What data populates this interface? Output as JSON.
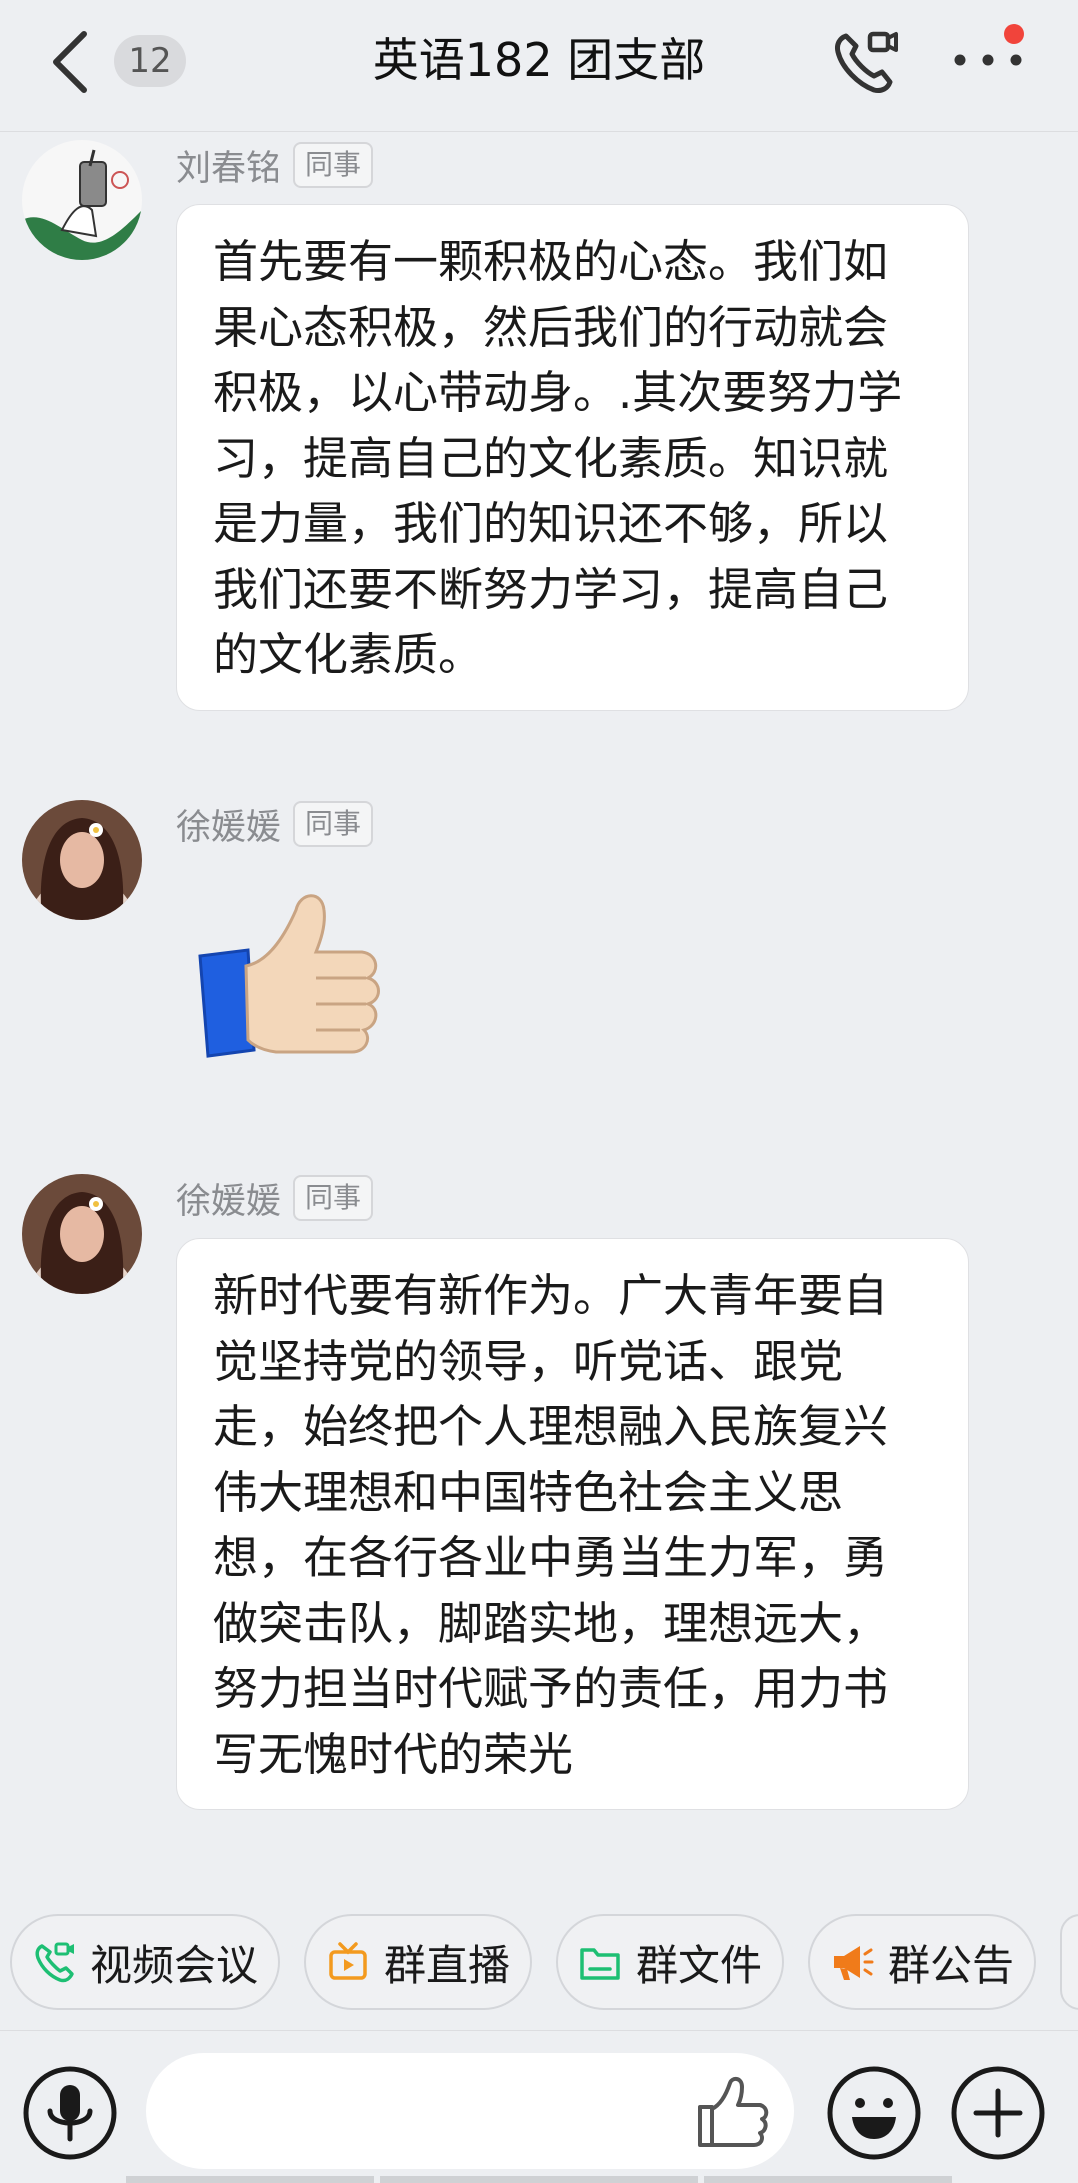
{
  "header": {
    "back_label": "back",
    "unread_count": "12",
    "title": "英语182 团支部",
    "has_notification_dot": true
  },
  "messages": [
    {
      "sender": "刘春铭",
      "tag": "同事",
      "text": "首先要有一颗积极的心态。我们如果心态积极，然后我们的行动就会积极，以心带动身。.其次要努力学习，提高自己的文化素质。知识就是力量，我们的知识还不够，所以我们还要不断努力学习，提高自己的文化素质。"
    },
    {
      "sender": "徐媛媛",
      "tag": "同事",
      "sticker": "thumbs-up"
    },
    {
      "sender": "徐媛媛",
      "tag": "同事",
      "text": "新时代要有新作为。广大青年要自觉坚持党的领导，听党话、跟党走，始终把个人理想融入民族复兴伟大理想和中国特色社会主义思想，在各行各业中勇当生力军，勇做突击队，脚踏实地，理想远大，努力担当时代赋予的责任，用力书写无愧时代的荣光"
    }
  ],
  "quick_actions": [
    {
      "label": "视频会议",
      "icon": "video-call-icon",
      "color": "#1dbf73"
    },
    {
      "label": "群直播",
      "icon": "live-tv-icon",
      "color": "#f39a1e"
    },
    {
      "label": "群文件",
      "icon": "folder-icon",
      "color": "#1dbf73"
    },
    {
      "label": "群公告",
      "icon": "megaphone-icon",
      "color": "#f07b1a"
    }
  ],
  "input": {
    "placeholder": ""
  },
  "colors": {
    "background": "#edeff2",
    "bubble": "#ffffff",
    "badge_red": "#f1443b"
  }
}
